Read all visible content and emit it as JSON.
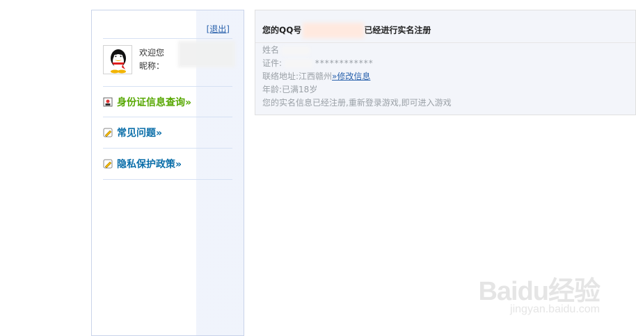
{
  "sidebar": {
    "logout_label": "[退出]",
    "welcome_label": "欢迎您",
    "nickname_label": "昵称：",
    "nav": [
      {
        "label": "身份证信息查询»"
      },
      {
        "label": "常见问题»"
      },
      {
        "label": "隐私保护政策»"
      }
    ]
  },
  "main": {
    "title_prefix": "您的QQ号",
    "title_suffix": "已经进行实名注册",
    "name_label": "姓名",
    "id_label": "证件:",
    "id_mask": "************",
    "address_prefix": "联络地址:江西赣州",
    "address_link": "»修改信息",
    "age_text": "年龄:已满18岁",
    "status_text": "您的实名信息已经注册,重新登录游戏,即可进入游戏"
  },
  "watermark": {
    "brand": "Baidu经验",
    "url": "jingyan.baidu.com"
  },
  "colors": {
    "accent": "#0a6ea9",
    "accent_green": "#56a700",
    "link": "#2b63ad"
  }
}
